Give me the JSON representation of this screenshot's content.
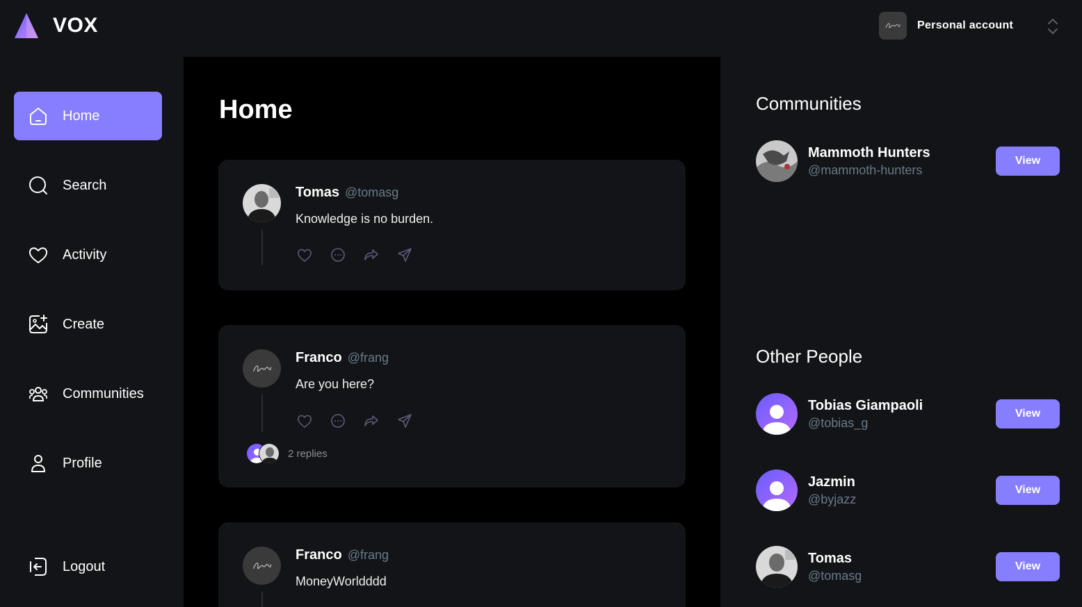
{
  "app": {
    "name": "VOX",
    "accent": "#877eff"
  },
  "account": {
    "label": "Personal account",
    "avatar_icon": "signature-avatar"
  },
  "sidebar": {
    "items": [
      {
        "label": "Home",
        "icon": "home-icon",
        "active": true
      },
      {
        "label": "Search",
        "icon": "search-icon",
        "active": false
      },
      {
        "label": "Activity",
        "icon": "heart-icon",
        "active": false
      },
      {
        "label": "Create",
        "icon": "create-image-icon",
        "active": false
      },
      {
        "label": "Communities",
        "icon": "people-icon",
        "active": false
      },
      {
        "label": "Profile",
        "icon": "user-icon",
        "active": false
      }
    ],
    "logout": "Logout"
  },
  "main": {
    "title": "Home",
    "posts": [
      {
        "name": "Tomas",
        "handle": "@tomasg",
        "text": "Knowledge is no burden.",
        "avatar": "photo-avatar"
      },
      {
        "name": "Franco",
        "handle": "@frang",
        "text": "Are you here?",
        "avatar": "signature-avatar",
        "replies": "2 replies"
      },
      {
        "name": "Franco",
        "handle": "@frang",
        "text": "MoneyWorldddd",
        "avatar": "signature-avatar"
      }
    ]
  },
  "right": {
    "communities_title": "Communities",
    "communities": [
      {
        "name": "Mammoth Hunters",
        "handle": "@mammoth-hunters",
        "button": "View"
      }
    ],
    "people_title": "Other People",
    "people": [
      {
        "name": "Tobias Giampaoli",
        "handle": "@tobias_g",
        "button": "View"
      },
      {
        "name": "Jazmin",
        "handle": "@byjazz",
        "button": "View"
      },
      {
        "name": "Tomas",
        "handle": "@tomasg",
        "button": "View"
      }
    ]
  }
}
